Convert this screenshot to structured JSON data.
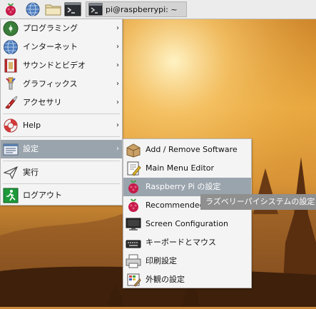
{
  "taskbar": {
    "window_title": "pi@raspberrypi: ~",
    "launchers": [
      "raspberry-menu-icon",
      "web-browser-icon",
      "file-manager-icon",
      "terminal-icon"
    ]
  },
  "main_menu": {
    "items": [
      {
        "label": "プログラミング",
        "icon": "programming-icon",
        "submenu": true
      },
      {
        "label": "インターネット",
        "icon": "internet-globe-icon",
        "submenu": true
      },
      {
        "label": "サウンドとビデオ",
        "icon": "sound-video-icon",
        "submenu": true
      },
      {
        "label": "グラフィックス",
        "icon": "graphics-brush-icon",
        "submenu": true
      },
      {
        "label": "アクセサリ",
        "icon": "accessories-knife-icon",
        "submenu": true
      },
      {
        "label": "Help",
        "icon": "help-lifebuoy-icon",
        "submenu": true
      },
      {
        "label": "設定",
        "icon": "preferences-icon",
        "submenu": true,
        "selected": true
      },
      {
        "label": "実行",
        "icon": "run-paperplane-icon",
        "submenu": false
      },
      {
        "label": "ログアウト",
        "icon": "logout-running-man-icon",
        "submenu": false
      }
    ]
  },
  "sub_menu": {
    "items": [
      {
        "label": "Add / Remove Software",
        "icon": "package-box-icon"
      },
      {
        "label": "Main Menu Editor",
        "icon": "menu-editor-icon"
      },
      {
        "label": "Raspberry Pi の設定",
        "icon": "raspberry-pi-icon",
        "selected": true
      },
      {
        "label": "Recommended",
        "icon": "raspberry-pi-icon"
      },
      {
        "label": "Screen Configuration",
        "icon": "monitor-icon"
      },
      {
        "label": "キーボードとマウス",
        "icon": "keyboard-mouse-icon"
      },
      {
        "label": "印刷設定",
        "icon": "printer-icon"
      },
      {
        "label": "外観の設定",
        "icon": "appearance-icon"
      }
    ]
  },
  "tooltip": {
    "text": "ラズベリーパイシステムの設定"
  },
  "colors": {
    "selection": "#9aa4ad",
    "menu_bg": "#f4f4f4",
    "taskbar_bg": "#ececec",
    "tooltip_bg": "#8f8f8f"
  }
}
